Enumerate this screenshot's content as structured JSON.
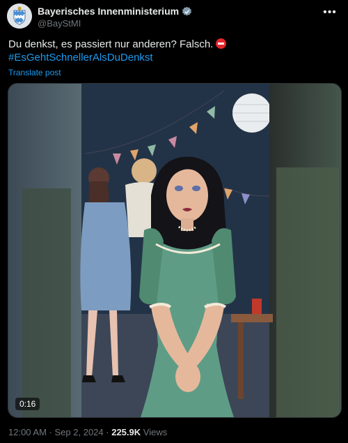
{
  "account": {
    "display_name": "Bayerisches Innenministerium",
    "handle": "@BayStMI"
  },
  "tweet": {
    "text": "Du denkst, es passiert nur anderen? Falsch.",
    "hashtag": "#EsGehtSchnellerAlsDuDenkst",
    "translate_label": "Translate post"
  },
  "video": {
    "duration": "0:16"
  },
  "meta": {
    "time": "12:00 AM",
    "date": "Sep 2, 2024",
    "views_count": "225.9K",
    "views_label": "Views"
  },
  "colors": {
    "link": "#1d9bf0",
    "secondary_text": "#71767b",
    "verified_badge": "#829aab",
    "dress": "#5f9c86"
  },
  "icons": [
    "bavaria-crest-icon",
    "verified-badge-icon",
    "more-options-icon",
    "stop-sign-emoji"
  ]
}
